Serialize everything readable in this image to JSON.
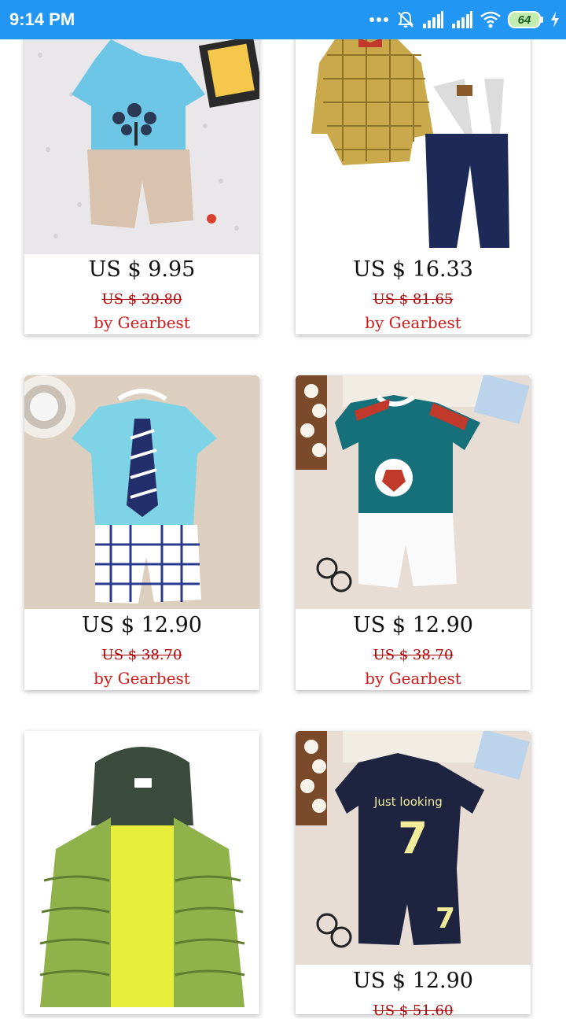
{
  "status_bar": {
    "time": "9:14 PM",
    "battery_level": "64",
    "icons": [
      "more-dots-icon",
      "alarm-off-icon",
      "signal-icon",
      "signal-icon",
      "wifi-icon",
      "battery-icon",
      "charging-icon"
    ]
  },
  "products": [
    {
      "image_icon": "kids-tshirt-tree-shorts-image",
      "price": "US $ 9.95",
      "original_price": "US $ 39.80",
      "seller": "by Gearbest"
    },
    {
      "image_icon": "plaid-romper-suspender-pants-image",
      "price": "US $ 16.33",
      "original_price": "US $ 81.65",
      "seller": "by Gearbest"
    },
    {
      "image_icon": "tie-print-tshirt-plaid-shorts-image",
      "price": "US $ 12.90",
      "original_price": "US $ 38.70",
      "seller": "by Gearbest"
    },
    {
      "image_icon": "football-tshirt-white-shorts-image",
      "price": "US $ 12.90",
      "original_price": "US $ 38.70",
      "seller": "by Gearbest"
    },
    {
      "image_icon": "green-puffer-jacket-image",
      "price": "",
      "original_price": "",
      "seller": ""
    },
    {
      "image_icon": "just-looking-7-outfit-image",
      "price": "US $ 12.90",
      "original_price": "US $ 51.60",
      "seller": ""
    }
  ],
  "product_texts": {
    "just_looking": "Just looking",
    "seven": "7"
  },
  "colors": {
    "status_bar": "#2196f3",
    "seller_red": "#d11a1a",
    "old_price_red": "#b30000"
  }
}
